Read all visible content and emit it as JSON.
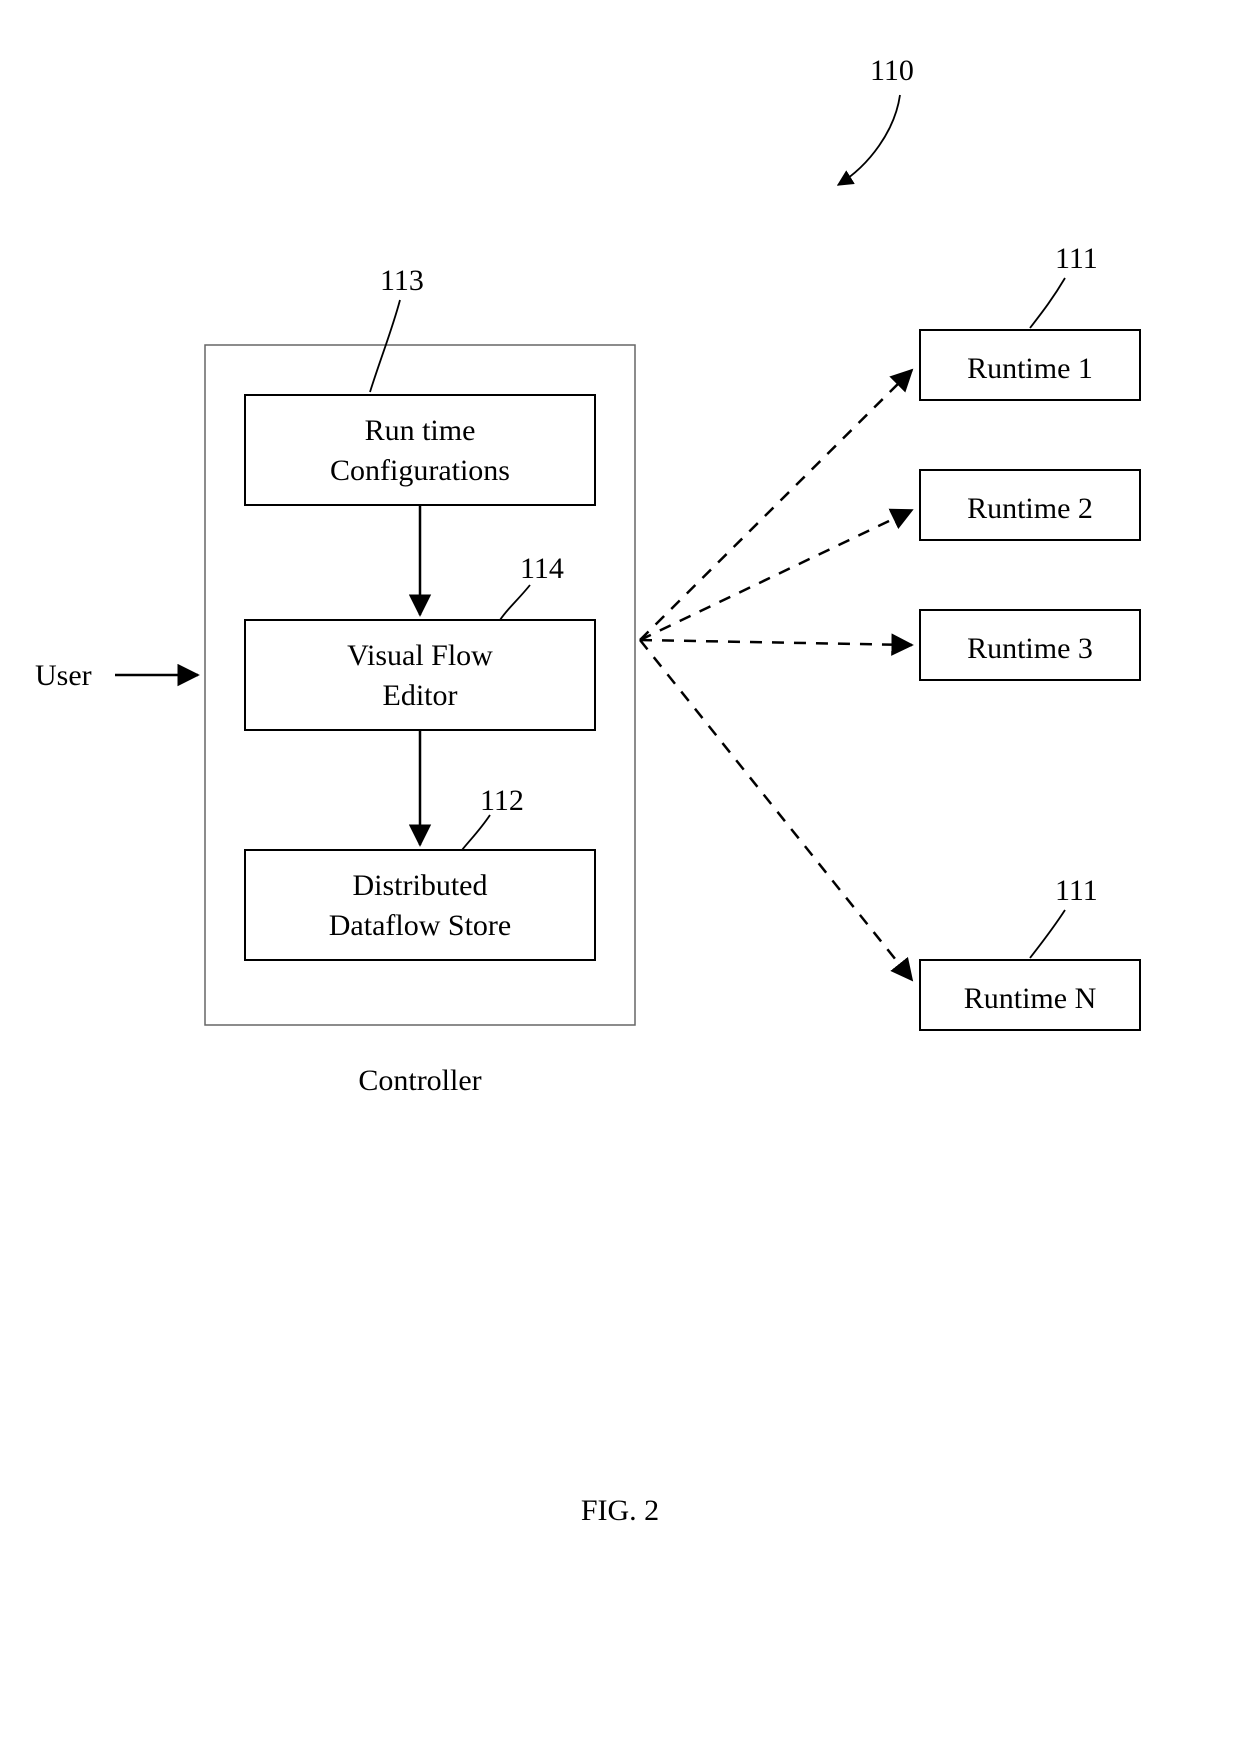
{
  "refs": {
    "system": "110",
    "runtime_top": "111",
    "runtime_bottom": "111",
    "config": "113",
    "editor": "114",
    "store": "112"
  },
  "labels": {
    "user": "User",
    "controller": "Controller",
    "figure": "FIG. 2"
  },
  "controller_blocks": {
    "config_l1": "Run time",
    "config_l2": "Configurations",
    "editor_l1": "Visual Flow",
    "editor_l2": "Editor",
    "store_l1": "Distributed",
    "store_l2": "Dataflow Store"
  },
  "runtimes": {
    "r1": "Runtime 1",
    "r2": "Runtime 2",
    "r3": "Runtime 3",
    "rn": "Runtime N"
  }
}
